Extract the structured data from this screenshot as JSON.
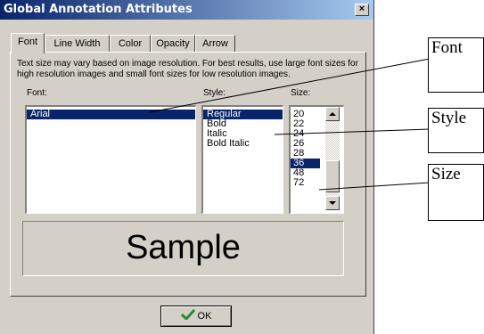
{
  "window": {
    "title": "Global Annotation Attributes",
    "close_glyph": "×"
  },
  "tabs": [
    {
      "label": "Font"
    },
    {
      "label": "Line Width"
    },
    {
      "label": "Color"
    },
    {
      "label": "Opacity"
    },
    {
      "label": "Arrow"
    }
  ],
  "info_text": "Text size may vary based on image resolution. For best results, use large font sizes for high resolution images and small font sizes for low resolution images.",
  "font_list": {
    "label": "Font:",
    "items": [
      "Arial"
    ],
    "selected": "Arial"
  },
  "style_list": {
    "label": "Style:",
    "items": [
      "Regular",
      "Bold",
      "Italic",
      "Bold Italic"
    ],
    "selected": "Regular"
  },
  "size_list": {
    "label": "Size:",
    "items": [
      "20",
      "22",
      "24",
      "26",
      "28",
      "36",
      "48",
      "72"
    ],
    "selected": "36"
  },
  "sample": {
    "text": "Sample"
  },
  "ok_button": {
    "label": "OK",
    "icon": "checkmark-icon",
    "icon_color": "#2a8a2a"
  },
  "callouts": {
    "font": "Font",
    "style": "Style",
    "size": "Size"
  },
  "colors": {
    "title_gradient_start": "#0a246a",
    "title_gradient_end": "#a6caf0",
    "selection": "#0a246a",
    "dialog_face": "#d4d0c8"
  }
}
